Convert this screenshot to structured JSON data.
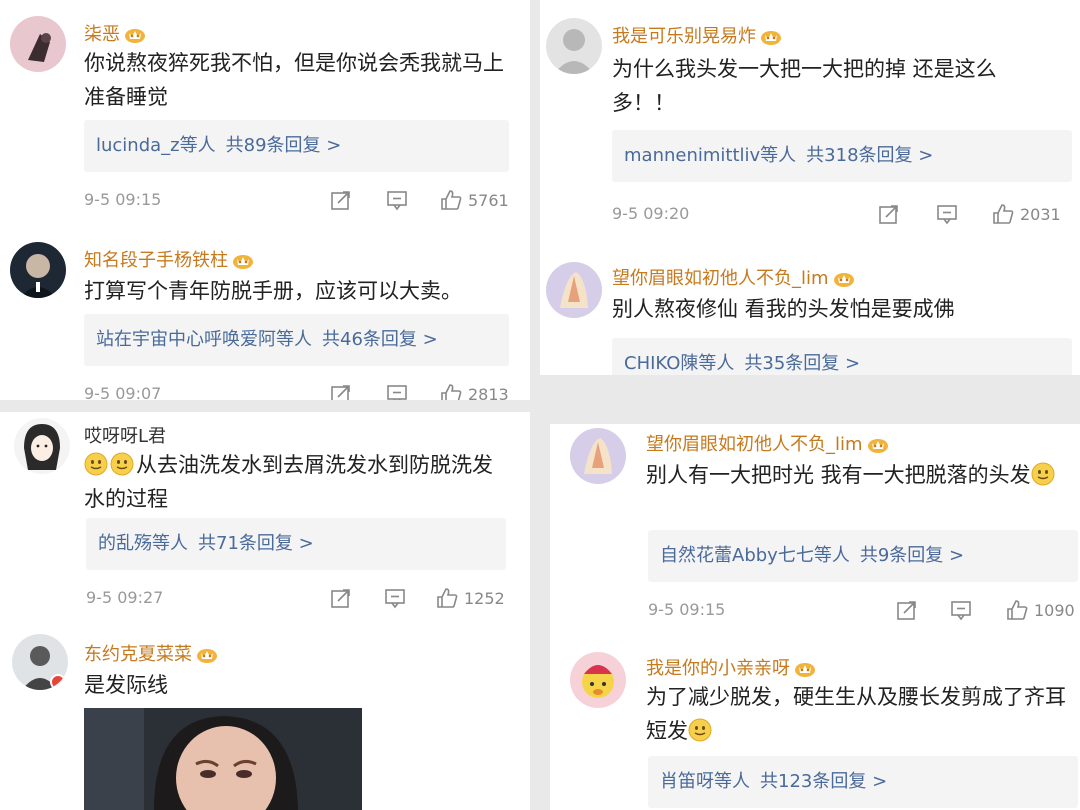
{
  "left": {
    "comments": [
      {
        "name": "柒恶",
        "text": "你说熬夜猝死我不怕，但是你说会秃我就马上准备睡觉",
        "reply_users": "lucinda_z等人",
        "reply_count": "共89条回复 >",
        "time": "9-5 09:15",
        "likes": "5761"
      },
      {
        "name": "知名段子手杨铁柱",
        "text": "打算写个青年防脱手册，应该可以大卖。",
        "reply_users": "站在宇宙中心呼唤爱阿等人",
        "reply_count": "共46条回复 >",
        "time": "9-5 09:07",
        "likes": "2813"
      },
      {
        "name": "哎呀呀L君",
        "text": "从去油洗发水到去屑洗发水到防脱洗发水的过程",
        "reply_users": "的乱殇等人",
        "reply_count": "共71条回复 >",
        "time": "9-5 09:27",
        "likes": "1252"
      },
      {
        "name": "东约克夏菜菜",
        "text": "是发际线"
      }
    ]
  },
  "right": {
    "comments": [
      {
        "name": "我是可乐别晃易炸",
        "text": "为什么我头发一大把一大把的掉 还是这么多！！",
        "reply_users": "mannenimittliv等人",
        "reply_count": "共318条回复 >",
        "time": "9-5 09:20",
        "likes": "2031"
      },
      {
        "name": "望你眉眼如初他人不负_lim",
        "text": "别人熬夜修仙 看我的头发怕是要成佛",
        "reply_users": "CHIKO陳等人",
        "reply_count": "共35条回复 >"
      },
      {
        "name": "望你眉眼如初他人不负_lim",
        "text": "别人有一大把时光  我有一大把脱落的头发",
        "reply_users": "自然花蕾Abby七七等人",
        "reply_count": "共9条回复 >",
        "time": "9-5 09:15",
        "likes": "1090"
      },
      {
        "name": "我是你的小亲亲呀",
        "text": "为了减少脱发，硬生生从及腰长发剪成了齐耳短发",
        "reply_users": "肖笛呀等人",
        "reply_count": "共123条回复 >"
      }
    ]
  },
  "colors": {
    "username": "#c67a1e",
    "reply_link": "#4a6a9a",
    "meta": "#999999"
  },
  "icons": [
    "crown-badge-icon",
    "share-icon",
    "comment-icon",
    "like-icon",
    "emoji-icon"
  ]
}
